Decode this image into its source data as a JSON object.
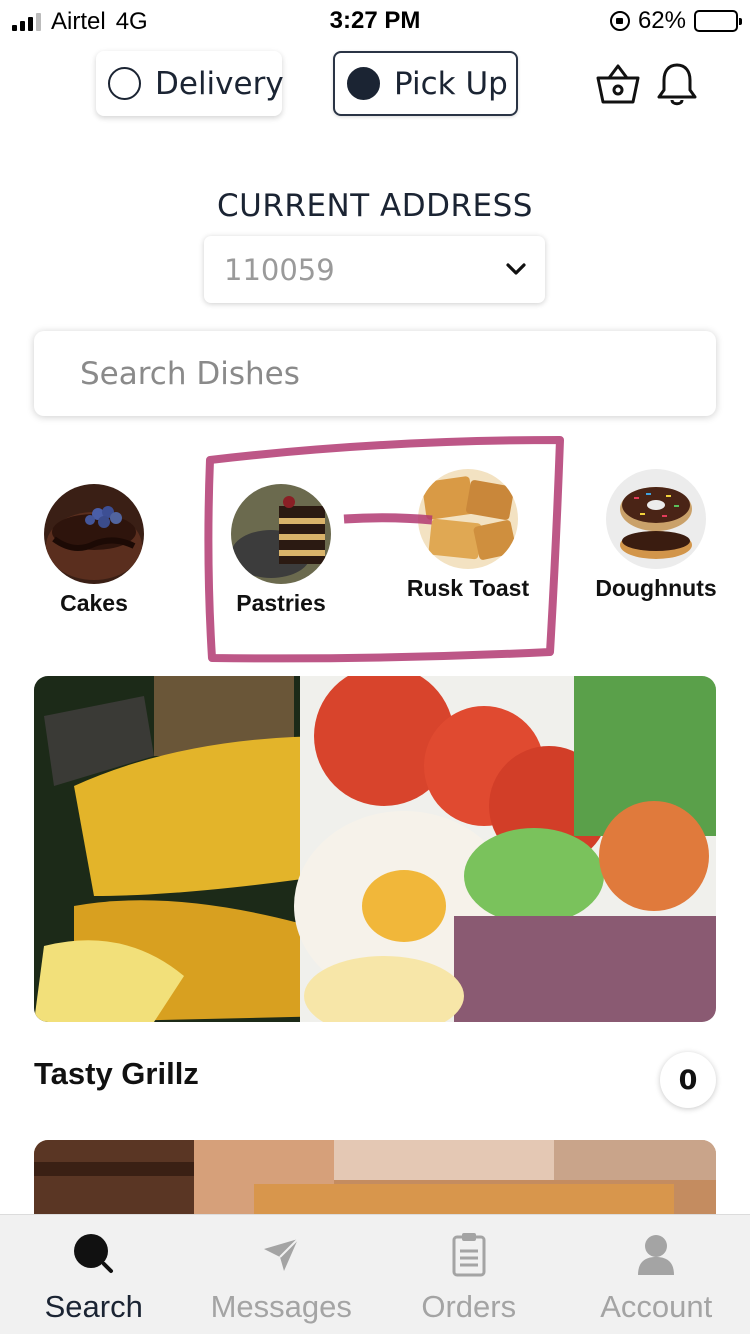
{
  "status_bar": {
    "carrier": "Airtel",
    "network": "4G",
    "time": "3:27 PM",
    "battery": "62%",
    "battery_level": 0.62
  },
  "mode": {
    "options": [
      {
        "label": "Delivery",
        "selected": false
      },
      {
        "label": "Pick Up",
        "selected": true
      }
    ]
  },
  "header_icons": [
    "basket-icon",
    "bell-icon"
  ],
  "address": {
    "label": "CURRENT ADDRESS",
    "value": "110059"
  },
  "search": {
    "placeholder": "Search Dishes"
  },
  "categories": [
    {
      "label": "Cakes"
    },
    {
      "label": "Pastries"
    },
    {
      "label": "Rusk Toast"
    },
    {
      "label": "Doughnuts"
    }
  ],
  "restaurants": [
    {
      "name": "Tasty Grillz",
      "count": "0"
    }
  ],
  "tabbar": {
    "items": [
      {
        "label": "Search",
        "icon": "search-icon",
        "active": true
      },
      {
        "label": "Messages",
        "icon": "send-icon",
        "active": false
      },
      {
        "label": "Orders",
        "icon": "clipboard-icon",
        "active": false
      },
      {
        "label": "Account",
        "icon": "user-icon",
        "active": false
      }
    ]
  },
  "colors": {
    "accent": "#1b2433",
    "inactive": "#a4a4a4",
    "highlight_annotation": "#b23a72"
  }
}
